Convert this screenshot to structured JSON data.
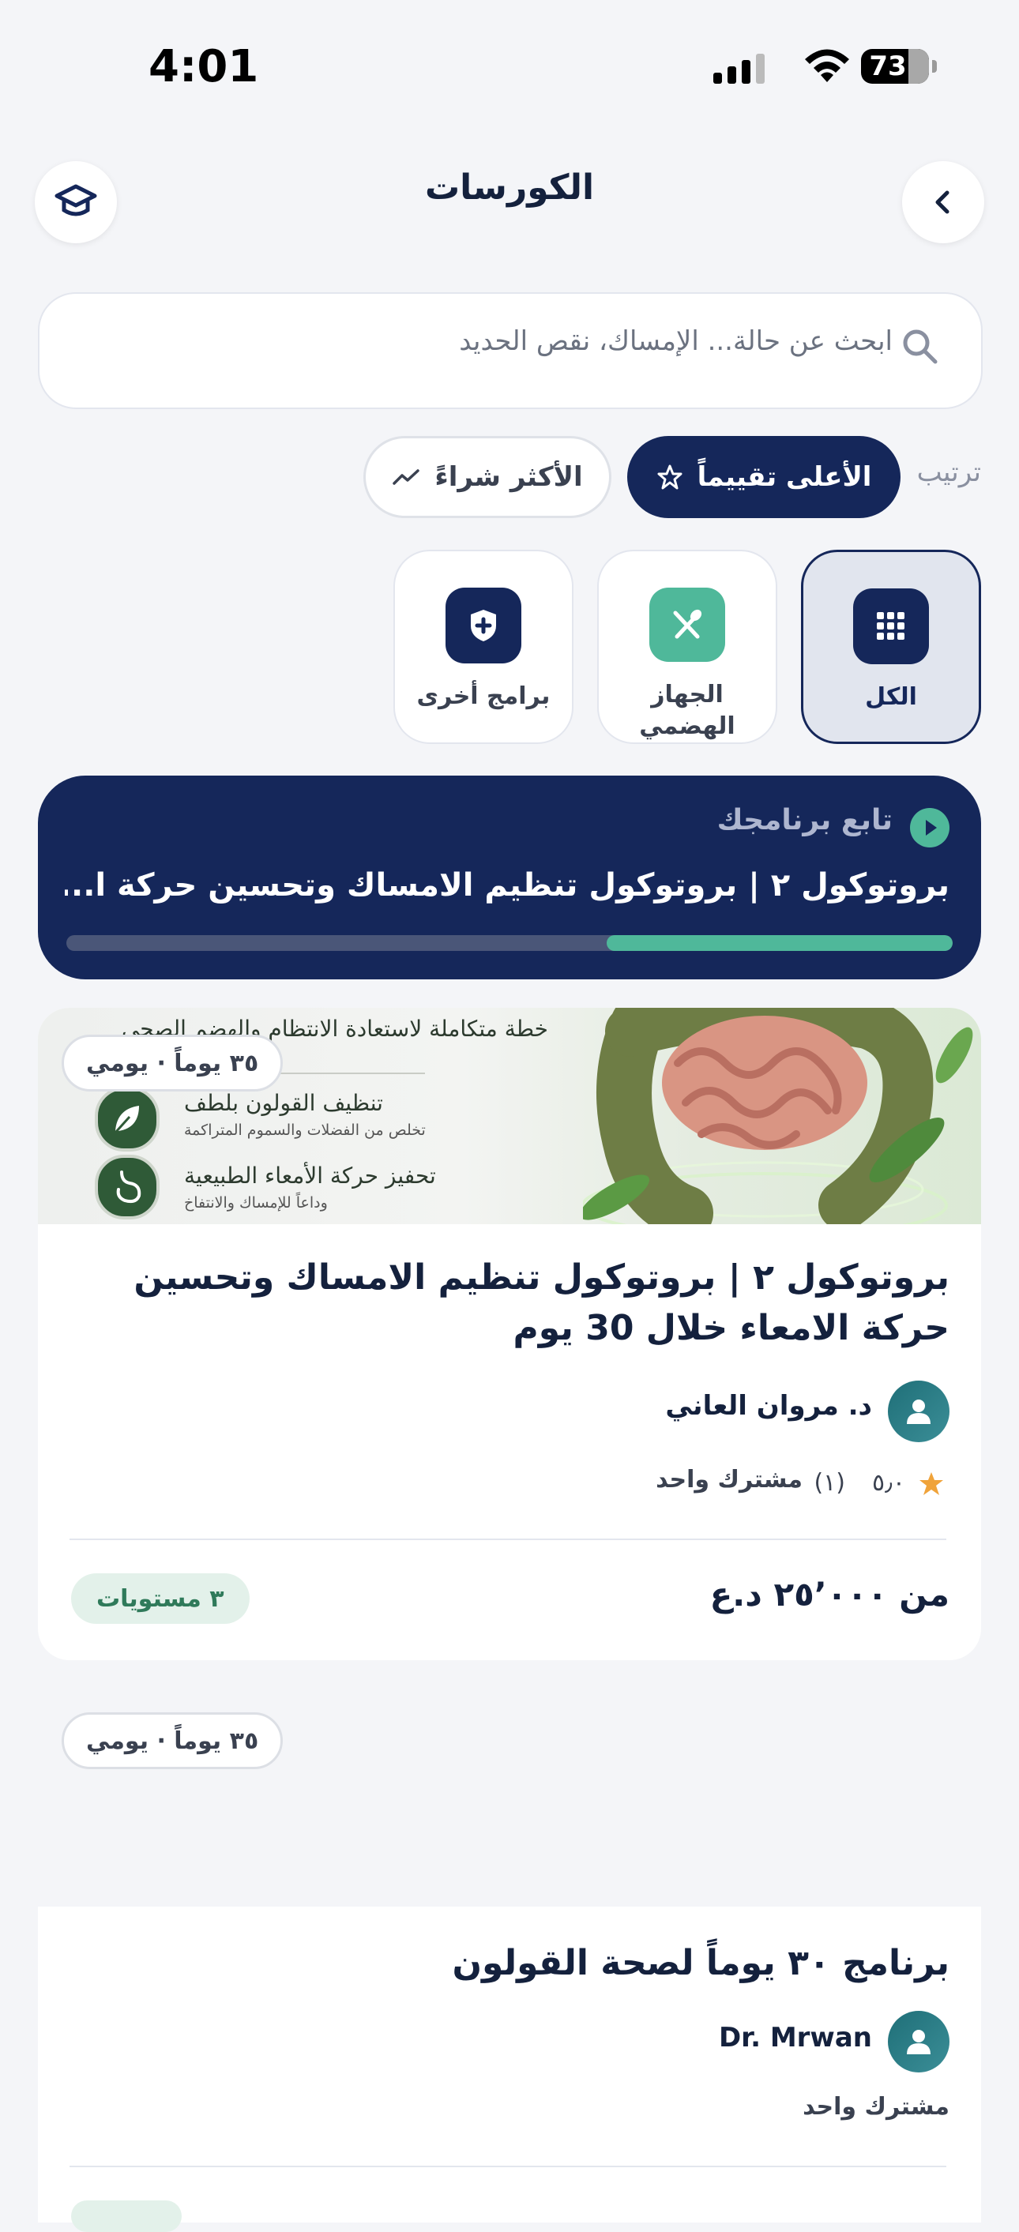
{
  "status_bar": {
    "time": "4:01",
    "battery": "73"
  },
  "header": {
    "title": "الكورسات"
  },
  "search": {
    "placeholder": "ابحث عن حالة... الإمساك، نقص الحديد"
  },
  "sort": {
    "label": "ترتيب",
    "options": [
      "الأعلى تقييماً",
      "الأكثر شراءً"
    ],
    "selected": "الأعلى تقييماً"
  },
  "categories": [
    {
      "label": "الكل",
      "icon": "grid-icon",
      "color": "#15275a",
      "active": true
    },
    {
      "label": "الجهاز الهضمي",
      "icon": "utensils-icon",
      "color": "#4fb89a",
      "active": false
    },
    {
      "label": "برامج أخرى",
      "icon": "shield-plus-icon",
      "color": "#15275a",
      "active": false
    }
  ],
  "continue_program": {
    "label": "تابع برنامجك",
    "title": "بروتوكول ٢ | بروتوكول تنظيم الامساك وتحسين حركة ا...",
    "progress": 0.39
  },
  "courses": [
    {
      "duration_badge": "٣٥ يوماً · يومي",
      "hero": {
        "headline": "خطة متكاملة لاستعادة الانتظام والهضم الصحي",
        "point1_title": "تنظيف القولون بلطف",
        "point1_sub": "تخلص من الفضلات والسموم المتراكمة",
        "point2_title": "تحفيز حركة الأمعاء الطبيعية",
        "point2_sub": "وداعاً للإمساك والانتفاخ"
      },
      "title": "بروتوكول ٢ | بروتوكول تنظيم الامساك وتحسين حركة الامعاء خلال 30 يوم",
      "author": "د. مروان العاني",
      "rating": "٥٫٠",
      "rating_count": "(١)",
      "subscribers": "مشترك واحد",
      "price": "من ٢٥٬٠٠٠ د.ع",
      "levels": "٣ مستويات"
    },
    {
      "duration_badge": "٣٥ يوماً · يومي",
      "title": "برنامج ٣٠ يوماً لصحة القولون",
      "author": "Dr. Mrwan",
      "subscribers": "مشترك واحد"
    }
  ],
  "colors": {
    "navy": "#15275a",
    "accent": "#4fb89a",
    "star": "#f0a33a"
  }
}
